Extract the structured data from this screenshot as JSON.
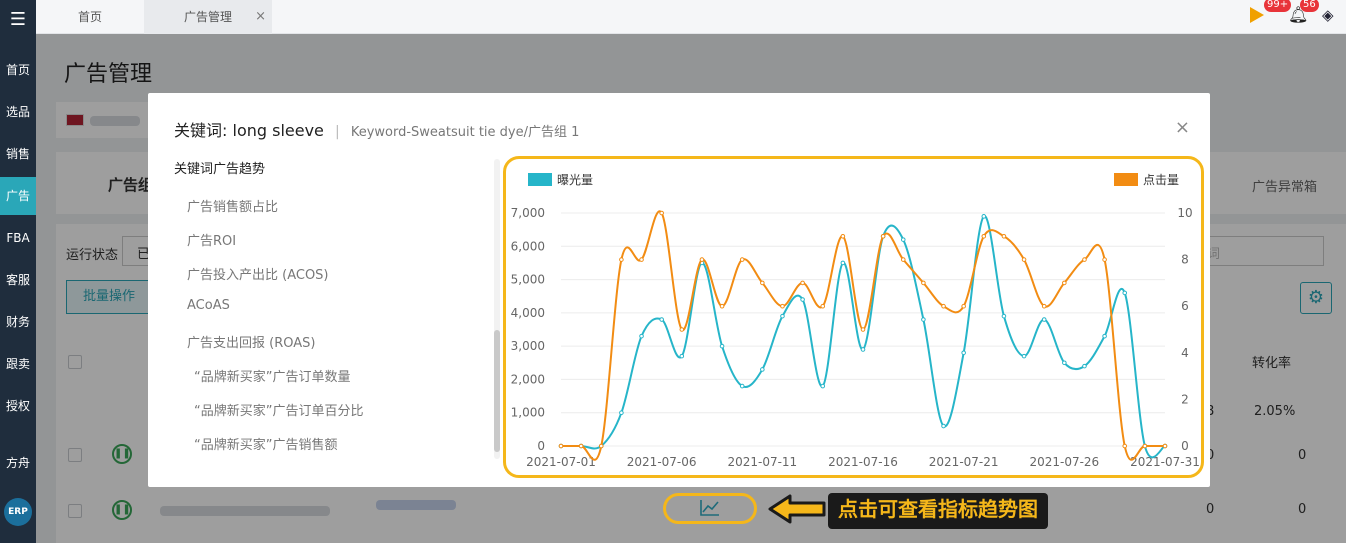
{
  "sidebar": {
    "items": [
      "首页",
      "选品",
      "销售",
      "广告",
      "FBA",
      "客服",
      "财务",
      "跟卖",
      "授权",
      "方舟"
    ],
    "active": "广告",
    "erp_label": "ERP"
  },
  "topbar": {
    "tabs": [
      {
        "label": "首页"
      },
      {
        "label": "广告管理"
      }
    ],
    "tab_close": "×",
    "badge_flag": "99+",
    "badge_bell": "56"
  },
  "page": {
    "title": "广告管理",
    "partial_tab": "广告组",
    "right_tab": "广告异常箱",
    "filter_label": "运行状态",
    "filter_value": "已",
    "search_hint": "词",
    "batch_button": "批量操作",
    "col_conversion": "转化率",
    "row_values": [
      "8",
      "2.05%",
      "0",
      "0",
      "0",
      "0"
    ]
  },
  "modal": {
    "title_prefix": "关键词:",
    "keyword": "long sleeve",
    "separator": "|",
    "subtitle": "Keyword-Sweatsuit tie dye/广告组 1",
    "close": "×",
    "metric_header": "关键词广告趋势",
    "metrics": [
      "广告销售额占比",
      "广告ROI",
      "广告投入产出比 (ACOS)",
      "ACoAS",
      "广告支出回报 (ROAS)",
      "“品牌新买家”广告订单数量",
      "“品牌新买家”广告订单百分比",
      "“品牌新买家”广告销售额"
    ]
  },
  "annotation": {
    "trend_icon": "trend-chart-icon",
    "arrow_icon": "arrow-left-icon",
    "callout": "点击可查看指标趋势图"
  },
  "colors": {
    "accent": "#2aa7b8",
    "impressions": "#26b5c9",
    "clicks": "#f28c13",
    "highlight": "#f5b71a"
  },
  "chart_data": {
    "type": "line",
    "x": [
      "2021-07-01",
      "2021-07-02",
      "2021-07-03",
      "2021-07-04",
      "2021-07-05",
      "2021-07-06",
      "2021-07-07",
      "2021-07-08",
      "2021-07-09",
      "2021-07-10",
      "2021-07-11",
      "2021-07-12",
      "2021-07-13",
      "2021-07-14",
      "2021-07-15",
      "2021-07-16",
      "2021-07-17",
      "2021-07-18",
      "2021-07-19",
      "2021-07-20",
      "2021-07-21",
      "2021-07-22",
      "2021-07-23",
      "2021-07-24",
      "2021-07-25",
      "2021-07-26",
      "2021-07-27",
      "2021-07-28",
      "2021-07-29",
      "2021-07-30",
      "2021-07-31"
    ],
    "x_tick_labels": [
      "2021-07-01",
      "2021-07-06",
      "2021-07-11",
      "2021-07-16",
      "2021-07-21",
      "2021-07-26",
      "2021-07-31"
    ],
    "series": [
      {
        "name": "曝光量",
        "axis": "left",
        "color": "#26b5c9",
        "values": [
          0,
          0,
          0,
          1000,
          3300,
          3800,
          2700,
          5500,
          3000,
          1800,
          2300,
          3900,
          4400,
          1800,
          5500,
          2900,
          6300,
          6200,
          3800,
          600,
          2800,
          6900,
          3900,
          2700,
          3800,
          2500,
          2400,
          3300,
          4600,
          0,
          0
        ]
      },
      {
        "name": "点击量",
        "axis": "right",
        "color": "#f28c13",
        "values": [
          0,
          0,
          0,
          8,
          8,
          10,
          5,
          8,
          6,
          8,
          7,
          6,
          7,
          6,
          9,
          5,
          9,
          8,
          7,
          6,
          6,
          9,
          9,
          8,
          6,
          7,
          8,
          8,
          0,
          0,
          0
        ]
      }
    ],
    "y_left": {
      "min": 0,
      "max": 7000,
      "ticks": [
        0,
        1000,
        2000,
        3000,
        4000,
        5000,
        6000,
        7000
      ],
      "tick_labels": [
        "0",
        "1,000",
        "2,000",
        "3,000",
        "4,000",
        "5,000",
        "6,000",
        "7,000"
      ]
    },
    "y_right": {
      "min": 0,
      "max": 10,
      "ticks": [
        0,
        2,
        4,
        6,
        8,
        10
      ]
    },
    "legend_placement": "top",
    "grid": true
  }
}
